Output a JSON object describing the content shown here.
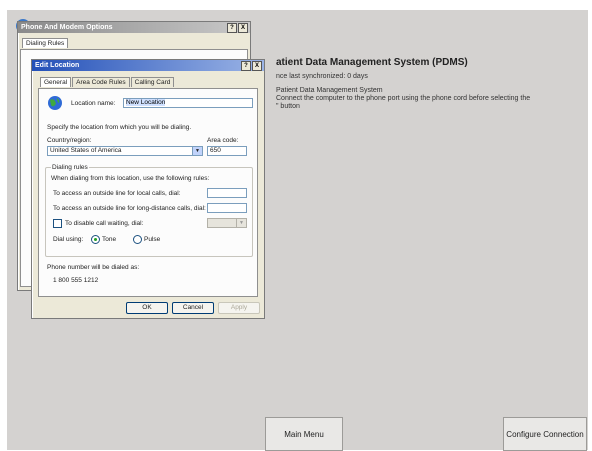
{
  "app": {
    "logo_text": "",
    "title": "atient Data Management System (PDMS)",
    "sync_status": "nce last synchronized: 0 days",
    "instructions": "Patient Data Management System\nConnect the computer to the phone port using the phone cord before selecting the\n\" button",
    "main_menu_label": "Main Menu",
    "configure_label": "Configure Connection"
  },
  "phone_modem": {
    "title": "Phone And Modem Options",
    "help_btn": "?",
    "close_btn": "X",
    "tab": "Dialing Rules"
  },
  "edit_location": {
    "title": "Edit Location",
    "help_btn": "?",
    "close_btn": "X",
    "tabs": [
      "General",
      "Area Code Rules",
      "Calling Card"
    ],
    "location_name_label": "Location name:",
    "location_name_value": "New Location",
    "specify_text": "Specify the location from which you will be dialing.",
    "country_label": "Country/region:",
    "country_value": "United States of America",
    "area_code_label": "Area code:",
    "area_code_value": "650",
    "dialing_rules_label": "Dialing rules",
    "rules_intro": "When dialing from this location, use the following rules:",
    "local_label": "To access an outside line for local calls, dial:",
    "local_value": "",
    "long_distance_label": "To access an outside line for long-distance calls, dial:",
    "long_distance_value": "",
    "call_waiting_label": "To disable call waiting, dial:",
    "call_waiting_value": "",
    "dial_using_label": "Dial using:",
    "tone_label": "Tone",
    "pulse_label": "Pulse",
    "dial_mode": "Tone",
    "phone_dialed_label": "Phone number will be dialed as:",
    "phone_dialed_value": "1 800 555 1212",
    "ok_label": "OK",
    "cancel_label": "Cancel",
    "apply_label": "Apply"
  },
  "colors": {
    "titlebar_active": "#2350b8",
    "app_background": "#d4d2d0",
    "dialog_background": "#ece9d8"
  },
  "icons": [
    "globe-icon",
    "dropdown-arrow-icon",
    "help-icon",
    "close-icon"
  ]
}
